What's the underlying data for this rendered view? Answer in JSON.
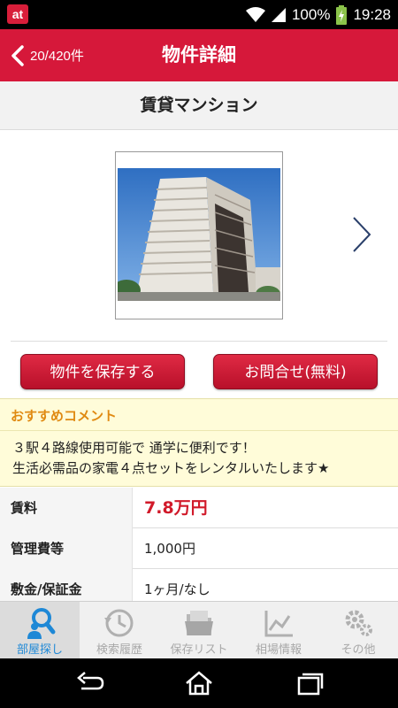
{
  "status_bar": {
    "app_badge": "at",
    "battery": "100%",
    "time": "19:28"
  },
  "header": {
    "back_label": "20/420件",
    "title": "物件詳細"
  },
  "property": {
    "type": "賃貸マンション"
  },
  "actions": {
    "save_label": "物件を保存する",
    "contact_label": "お問合せ(無料)"
  },
  "comment": {
    "heading": "おすすめコメント",
    "lines": [
      "３駅４路線使用可能で 通学に便利です！",
      "生活必需品の家電４点セットをレンタルいたします★"
    ]
  },
  "spec": [
    {
      "label": "賃料",
      "value": "7.8万円"
    },
    {
      "label": "管理費等",
      "value": "1,000円"
    },
    {
      "label": "敷金/保証金",
      "value": "1ヶ月/なし"
    }
  ],
  "tabs": [
    {
      "label": "部屋探し",
      "icon": "search-person-icon",
      "active": true
    },
    {
      "label": "検索履歴",
      "icon": "history-clock-icon",
      "active": false
    },
    {
      "label": "保存リスト",
      "icon": "folder-icon",
      "active": false
    },
    {
      "label": "相場情報",
      "icon": "chart-icon",
      "active": false
    },
    {
      "label": "その他",
      "icon": "gear-icon",
      "active": false
    }
  ],
  "colors": {
    "brand_red": "#d6183a",
    "price_red": "#d11a2a",
    "comment_heading": "#e08a12",
    "tab_active": "#1e88d6"
  }
}
